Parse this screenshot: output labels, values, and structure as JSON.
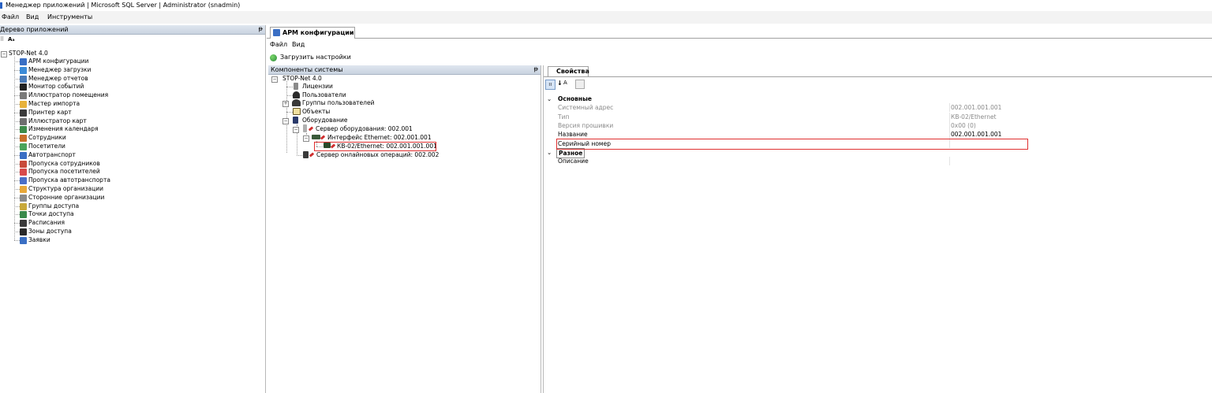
{
  "window": {
    "title": "Менеджер приложений | Microsoft SQL Server | Administrator  (snadmin)"
  },
  "menu": [
    "Файл",
    "Вид",
    "Инструменты"
  ],
  "left_panel": {
    "header": "Дерево приложений",
    "pin": "ᵽ",
    "root": "STOP-Net 4.0",
    "items": [
      {
        "label": "АРМ конфигурации",
        "color": "#3a6fc4"
      },
      {
        "label": "Менеджер загрузки",
        "color": "#3b8bd8"
      },
      {
        "label": "Менеджер отчетов",
        "color": "#4a7bb8"
      },
      {
        "label": "Монитор событий",
        "color": "#222222"
      },
      {
        "label": "Иллюстратор помещения",
        "color": "#7a7a7a"
      },
      {
        "label": "Мастер импорта",
        "color": "#e8b23a"
      },
      {
        "label": "Принтер карт",
        "color": "#3a3a3a"
      },
      {
        "label": "Иллюстратор карт",
        "color": "#6e6e6e"
      },
      {
        "label": "Изменения календаря",
        "color": "#3d8c4a"
      },
      {
        "label": "Сотрудники",
        "color": "#c8702a"
      },
      {
        "label": "Посетители",
        "color": "#4aa35a"
      },
      {
        "label": "Автотранспорт",
        "color": "#3a6fc4"
      },
      {
        "label": "Пропуска сотрудников",
        "color": "#c84a3a"
      },
      {
        "label": "Пропуска посетителей",
        "color": "#d84a4a"
      },
      {
        "label": "Пропуска автотранспорта",
        "color": "#4a6fc8"
      },
      {
        "label": "Структура организации",
        "color": "#e8a83a"
      },
      {
        "label": "Сторонние организации",
        "color": "#8a8a8a"
      },
      {
        "label": "Группы доступа",
        "color": "#c8a83a"
      },
      {
        "label": "Точки доступа",
        "color": "#3a8a4a"
      },
      {
        "label": "Расписания",
        "color": "#3a3a3a"
      },
      {
        "label": "Зоны доступа",
        "color": "#2a2a2a"
      },
      {
        "label": "Заявки",
        "color": "#3a6fc4"
      }
    ]
  },
  "tabs": [
    {
      "label": "АРМ конфигурации"
    }
  ],
  "sub_menu": [
    "Файл",
    "Вид"
  ],
  "toolbar": {
    "load_settings": "Загрузить настройки"
  },
  "components_panel": {
    "header": "Компоненты системы",
    "pin": "ᵽ",
    "root": "STOP-Net 4.0",
    "items": {
      "licenses": "Лицензии",
      "users": "Пользователи",
      "user_groups": "Группы пользователей",
      "objects": "Объекты",
      "equipment": "Оборудование",
      "equipment_server": "Сервер оборудования: 002.001",
      "ethernet_interface": "Интерфейс Ethernet: 002.001.001",
      "kb02": "КВ-02/Ethernet: 002.001.001.001",
      "online_server": "Сервер онлайновых операций: 002.002"
    }
  },
  "properties": {
    "tab": "Свойства",
    "categories": [
      {
        "name": "Основные",
        "rows": [
          {
            "name": "Системный адрес",
            "value": "002.001.001.001",
            "enabled": false
          },
          {
            "name": "Тип",
            "value": "КВ-02/Ethernet",
            "enabled": false
          },
          {
            "name": "Версия прошивки",
            "value": "0x00 (0)",
            "enabled": false
          },
          {
            "name": "Название",
            "value": "002.001.001.001",
            "enabled": true
          },
          {
            "name": "Серийный номер",
            "value": "",
            "enabled": true
          }
        ]
      },
      {
        "name": "Разное",
        "rows": [
          {
            "name": "Описание",
            "value": "",
            "enabled": true
          }
        ]
      }
    ]
  }
}
